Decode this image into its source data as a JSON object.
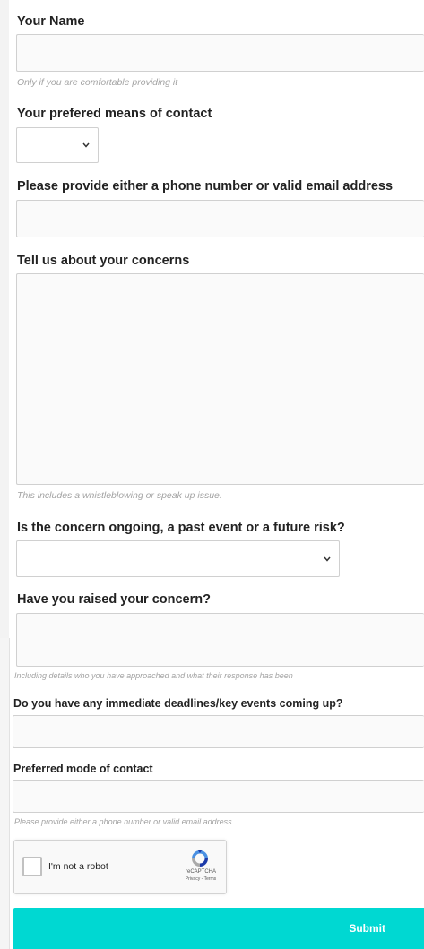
{
  "form": {
    "name": {
      "label": "Your Name",
      "value": "",
      "help": "Only if you are comfortable providing it"
    },
    "contact_means": {
      "label": "Your prefered means of contact",
      "selected": ""
    },
    "phone_email": {
      "label": "Please provide either a phone number or valid email address",
      "value": ""
    },
    "concerns": {
      "label": "Tell us about your concerns",
      "value": "",
      "help": "This includes a whistleblowing or speak up issue."
    },
    "timing": {
      "label": "Is the concern ongoing, a past event or a future risk?",
      "selected": ""
    },
    "raised": {
      "label": "Have you raised your concern?",
      "value": "",
      "help": "Including details who you have approached and what their response has been"
    },
    "deadlines": {
      "label": "Do you have any immediate deadlines/key events coming up?",
      "value": ""
    },
    "preferred_mode": {
      "label": "Preferred mode of contact",
      "value": "",
      "help": "Please provide either a phone number or valid email address"
    },
    "recaptcha": {
      "checkbox_label": "I'm not a robot",
      "brand": "reCAPTCHA",
      "privacy": "Privacy",
      "separator": " - ",
      "terms": "Terms"
    },
    "submit_label": "Submit"
  },
  "colors": {
    "accent": "#00d8d2",
    "recaptcha_blue": "#1c3aa9",
    "recaptcha_light": "#4a90e2",
    "help_text": "#a3a3a3"
  },
  "icons": {
    "select_arrow": "chevron-down-icon",
    "recaptcha": "recaptcha-logo-icon"
  }
}
